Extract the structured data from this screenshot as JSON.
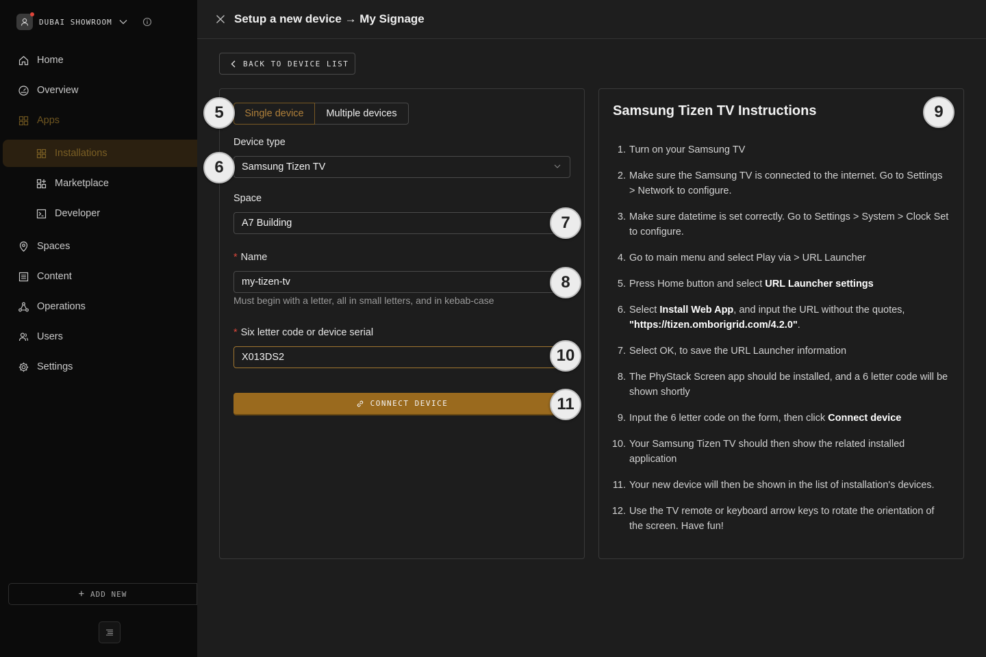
{
  "org": {
    "name": "DUBAI SHOWROOM"
  },
  "nav": {
    "home": "Home",
    "overview": "Overview",
    "apps": "Apps",
    "installations": "Installations",
    "marketplace": "Marketplace",
    "developer": "Developer",
    "spaces": "Spaces",
    "content": "Content",
    "operations": "Operations",
    "users": "Users",
    "settings": "Settings",
    "add_new": "ADD NEW"
  },
  "header": {
    "title": "Setup a new device → My Signage"
  },
  "back_button": "BACK TO DEVICE LIST",
  "form": {
    "tabs": {
      "single": "Single device",
      "multiple": "Multiple devices"
    },
    "device_type": {
      "label": "Device type",
      "value": "Samsung Tizen TV"
    },
    "space": {
      "label": "Space",
      "value": "A7 Building"
    },
    "name": {
      "label": "Name",
      "value": "my-tizen-tv",
      "hint": "Must begin with a letter, all in small letters, and in kebab-case"
    },
    "code": {
      "label": "Six letter code or device serial",
      "value": "X013DS2"
    },
    "connect_button": "CONNECT DEVICE"
  },
  "badges": {
    "b5": "5",
    "b6": "6",
    "b7": "7",
    "b8": "8",
    "b9": "9",
    "b10": "10",
    "b11": "11"
  },
  "instructions": {
    "title": "Samsung Tizen TV Instructions",
    "steps": [
      {
        "num": "1.",
        "a": "Turn on your Samsung TV"
      },
      {
        "num": "2.",
        "a": "Make sure the Samsung TV is connected to the internet. Go to Settings > Network to configure."
      },
      {
        "num": "3.",
        "a": "Make sure datetime is set correctly. Go to Settings > System > Clock Set to configure."
      },
      {
        "num": "4.",
        "a": "Go to main menu and select Play via > URL Launcher"
      },
      {
        "num": "5.",
        "a": "Press Home button and select ",
        "b": "URL Launcher settings"
      },
      {
        "num": "6.",
        "a": "Select ",
        "b": "Install Web App",
        "c": ", and input the URL without the quotes, ",
        "d": "\"https://tizen.omborigrid.com/4.2.0\"",
        "e": "."
      },
      {
        "num": "7.",
        "a": "Select OK, to save the URL Launcher information"
      },
      {
        "num": "8.",
        "a": "The PhyStack Screen app should be installed, and a 6 letter code will be shown shortly"
      },
      {
        "num": "9.",
        "a": "Input the 6 letter code on the form, then click ",
        "b": "Connect device"
      },
      {
        "num": "10.",
        "a": "Your Samsung Tizen TV should then show the related installed application"
      },
      {
        "num": "11.",
        "a": "Your new device will then be shown in the list of installation's devices."
      },
      {
        "num": "12.",
        "a": "Use the TV remote or keyboard arrow keys to rotate the orientation of the screen. Have fun!"
      }
    ]
  },
  "colors": {
    "accent": "#9a6a1e",
    "sidebar_bg": "#0b0b0b",
    "main_bg": "#1d1d1d",
    "required": "#d9473b"
  }
}
